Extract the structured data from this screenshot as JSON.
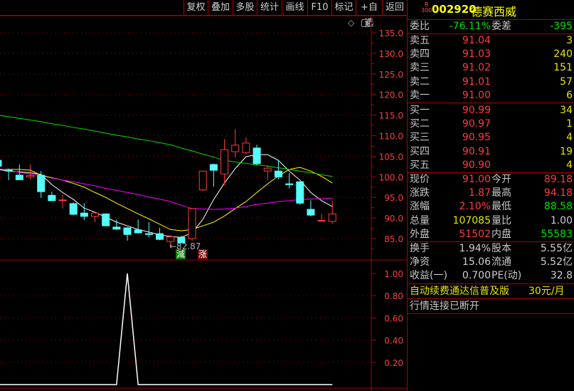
{
  "toolbar": [
    "复权",
    "叠加",
    "多股",
    "统计",
    "画线",
    "F10",
    "标记",
    "+自选",
    "返回"
  ],
  "stock": {
    "badge_r": "R",
    "badge_300": "300",
    "code": "002920",
    "name": "德赛西威"
  },
  "weibi": {
    "label": "委比",
    "value": "-76.11%",
    "label2": "委差",
    "value2": "-395"
  },
  "sell": [
    {
      "label": "卖五",
      "price": "91.04",
      "vol": "3"
    },
    {
      "label": "卖四",
      "price": "91.03",
      "vol": "240"
    },
    {
      "label": "卖三",
      "price": "91.02",
      "vol": "151"
    },
    {
      "label": "卖二",
      "price": "91.01",
      "vol": "57"
    },
    {
      "label": "卖一",
      "price": "91.00",
      "vol": "6"
    }
  ],
  "buy": [
    {
      "label": "买一",
      "price": "90.99",
      "vol": "34"
    },
    {
      "label": "买二",
      "price": "90.97",
      "vol": "1"
    },
    {
      "label": "买三",
      "price": "90.95",
      "vol": "4"
    },
    {
      "label": "买四",
      "price": "90.91",
      "vol": "19"
    },
    {
      "label": "买五",
      "price": "90.90",
      "vol": "4"
    }
  ],
  "quote": [
    {
      "l1": "现价",
      "v1": "91.00",
      "c1": "red",
      "l2": "今开",
      "v2": "89.18",
      "c2": "red"
    },
    {
      "l1": "涨跌",
      "v1": "1.87",
      "c1": "red",
      "l2": "最高",
      "v2": "94.18",
      "c2": "red"
    },
    {
      "l1": "涨幅",
      "v1": "2.10%",
      "c1": "red",
      "l2": "最低",
      "v2": "88.58",
      "c2": "grn"
    },
    {
      "l1": "总量",
      "v1": "107085",
      "c1": "yel",
      "l2": "量比",
      "v2": "1.00",
      "c2": "wht"
    },
    {
      "l1": "外盘",
      "v1": "51502",
      "c1": "red",
      "l2": "内盘",
      "v2": "55583",
      "c2": "grn"
    }
  ],
  "fund": [
    {
      "l1": "换手",
      "v1": "1.94%",
      "l2": "股本",
      "v2": "5.55亿"
    },
    {
      "l1": "净资",
      "v1": "15.06",
      "l2": "流通",
      "v2": "5.52亿"
    },
    {
      "l1": "收益(一)",
      "v1": "0.700",
      "l2": "PE(动)",
      "v2": "32.8"
    }
  ],
  "promo": {
    "text": "自动续费通达信普及版",
    "price": "30元/月"
  },
  "status": "行情连接已断开",
  "chart_data": [
    {
      "type": "candlestick",
      "ylim": [
        82,
        137
      ],
      "yticks": [
        "135.0",
        "130.0",
        "125.0",
        "120.0",
        "115.0",
        "110.0",
        "105.0",
        "100.0",
        "95.0",
        "90.0",
        "85.0"
      ],
      "low_marker": "←82.87",
      "signal_down": "減",
      "signal_up": "涨",
      "ohlc": [
        [
          104.0,
          104.3,
          102.4,
          102.6
        ],
        [
          101.6,
          102.0,
          99.2,
          101.4
        ],
        [
          100.4,
          103.0,
          99.2,
          99.3
        ],
        [
          100.0,
          103.0,
          99.4,
          100.3
        ],
        [
          100.4,
          101.4,
          94.9,
          96.4
        ],
        [
          95.5,
          96.4,
          94.2,
          94.2
        ],
        [
          94.3,
          95.7,
          92.3,
          94.4
        ],
        [
          93.5,
          93.8,
          90.7,
          90.9
        ],
        [
          91.2,
          93.6,
          89.5,
          90.4
        ],
        [
          90.4,
          91.6,
          89.0,
          91.2
        ],
        [
          91.0,
          91.0,
          88.1,
          88.1
        ],
        [
          87.8,
          89.6,
          87.1,
          87.3
        ],
        [
          87.6,
          87.8,
          84.5,
          86.0
        ],
        [
          87.1,
          89.6,
          86.2,
          86.4
        ],
        [
          86.2,
          89.0,
          85.3,
          86.0
        ],
        [
          86.2,
          87.6,
          84.6,
          84.8
        ],
        [
          84.3,
          85.9,
          82.87,
          85.4
        ],
        [
          85.3,
          85.7,
          84.0,
          84.0
        ],
        [
          85.0,
          92.3,
          84.5,
          92.3
        ],
        [
          96.8,
          101.4,
          96.6,
          101.4
        ],
        [
          103.0,
          103.2,
          97.6,
          101.6
        ],
        [
          100.7,
          109.2,
          98.0,
          106.6
        ],
        [
          106.1,
          111.6,
          104.7,
          107.7
        ],
        [
          105.9,
          109.6,
          105.4,
          108.2
        ],
        [
          107.0,
          107.8,
          102.8,
          103.2
        ],
        [
          101.4,
          102.8,
          99.2,
          102.1
        ],
        [
          101.4,
          104.0,
          99.4,
          100.0
        ],
        [
          98.3,
          100.9,
          97.2,
          98.1
        ],
        [
          98.8,
          98.8,
          93.2,
          93.6
        ],
        [
          92.1,
          94.3,
          90.4,
          90.7
        ],
        [
          89.3,
          91.0,
          89.3,
          89.4
        ],
        [
          89.18,
          94.18,
          88.58,
          91.0
        ]
      ],
      "ma": [
        {
          "color": "#ffffff",
          "values": [
            101.8,
            101.4,
            101.2,
            101.0,
            100.6,
            98.1,
            96.2,
            94.5,
            92.4,
            91.4,
            90.2,
            89.0,
            88.1,
            87.2,
            86.6,
            85.9,
            85.5,
            85.3,
            86.4,
            89.7,
            94.5,
            98.5,
            102.0,
            104.9,
            105.4,
            105.4,
            104.0,
            101.4,
            99.2,
            96.2,
            94.2,
            92.8
          ]
        },
        {
          "color": "#ffff00",
          "values": [
            101.8,
            101.8,
            101.8,
            101.6,
            100.4,
            99.8,
            99.2,
            98.4,
            97.5,
            96.2,
            95.0,
            93.6,
            92.3,
            91.0,
            89.8,
            88.5,
            87.2,
            86.9,
            87.2,
            88.1,
            89.0,
            90.5,
            92.3,
            94.0,
            96.2,
            98.3,
            100.2,
            101.8,
            102.3,
            101.4,
            100.1,
            98.5
          ]
        },
        {
          "color": "#ff00ff",
          "values": [
            102.0,
            101.6,
            101.1,
            100.7,
            100.2,
            99.7,
            99.2,
            98.8,
            98.3,
            97.8,
            97.2,
            96.7,
            96.2,
            95.7,
            95.1,
            94.6,
            94.0,
            93.1,
            92.3,
            92.2,
            92.1,
            92.2,
            92.4,
            92.8,
            93.3,
            93.6,
            94.0,
            94.2,
            94.5,
            94.6,
            94.7,
            94.8
          ]
        },
        {
          "color": "#00e000",
          "values": [
            115.0,
            114.6,
            114.2,
            113.8,
            113.4,
            112.9,
            112.5,
            112.0,
            111.6,
            111.1,
            110.6,
            110.1,
            109.7,
            109.2,
            108.8,
            108.3,
            107.8,
            107.0,
            106.3,
            105.5,
            104.8,
            104.0,
            103.6,
            103.3,
            102.9,
            102.6,
            102.2,
            101.8,
            101.4,
            101.0,
            100.5,
            100.1
          ]
        }
      ],
      "up_color": "#ff3c3c",
      "down_color": "#54ffff"
    },
    {
      "type": "line",
      "ylim": [
        0,
        1
      ],
      "yticks": [
        "1.00",
        "0.80",
        "0.60",
        "0.40",
        "0.20"
      ],
      "values": [
        0,
        0,
        0,
        0,
        0,
        0,
        0,
        0,
        0,
        0,
        0,
        0,
        1,
        0,
        0,
        0,
        0,
        0,
        0,
        0,
        0,
        0,
        0,
        0,
        0,
        0,
        0,
        0,
        0,
        0,
        0,
        0
      ]
    }
  ]
}
